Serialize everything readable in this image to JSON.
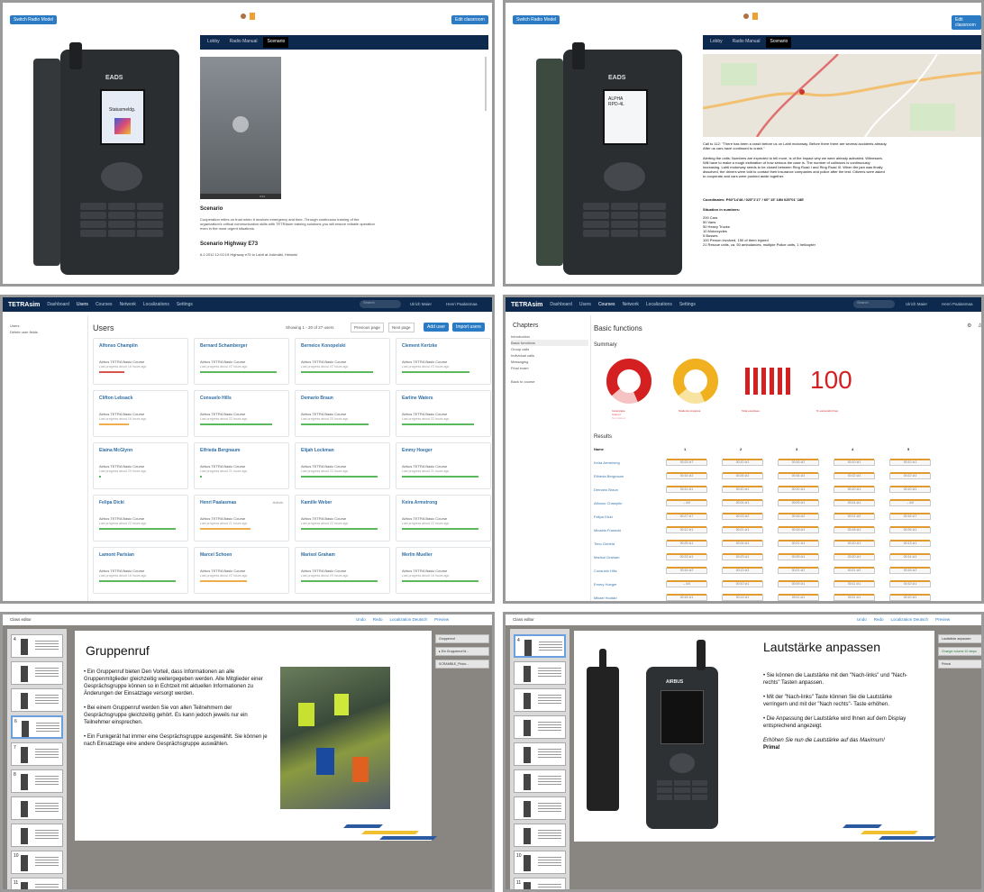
{
  "p1": {
    "switch_btn": "Switch Radio Model",
    "edit_btn": "Edit classroom",
    "tabs": [
      "Lobby",
      "Radio Manual",
      "Scenario"
    ],
    "active_tab": "Scenario",
    "radio_brand": "EADS",
    "radio_screen": "Statusmeldg.",
    "video_time": "2:21",
    "section_title": "Scenario",
    "section_text": "Cooperation relies on trust when it involves emergency and time. Through continuous training of the organization's critical communication skills with TETRAsim training solutions you will ensure reliable operation even in the most urgent situations.",
    "sub_title": "Scenario Highway E73",
    "sub_text": "6.2.2012 12:02:19 Highway e75 to Lahti at Jokimäki, Helsinki"
  },
  "p2": {
    "switch_btn": "Switch Radio Model",
    "edit_btn": "Edit classroom",
    "tabs": [
      "Lobby",
      "Radio Manual",
      "Scenario"
    ],
    "active_tab": "Scenario",
    "radio_brand": "EADS",
    "radio_screen": "ALPHA RPD-4L",
    "call_text": "Call to 112: \"There has been a crash before us on Lahti motorway. Before there there are several accidents already. After us cars have continued to crash.\"",
    "alerting_text": "Alerting the units: Numbers are expected to tell more, is of the impact why we were already activated. Witnesses. Will have to make a rough estimation of how serious the case is. The number of collisions is continuously increasing. Lahti motorway needs to be closed between Ring Road I and Ring Road III. When the jam was finally dissolved, the drivers were told to contact their insurance companies and police after the test. Citizens were asked to cooperate and cars were pushed aside together.",
    "coords": "Coordinates: P60°14'48 / 025°1'17' / 60° 15' 18N 025°01' 18E",
    "situation_title": "Situation in numbers:",
    "situation": [
      "200 Cars",
      "50 Vans",
      "50 Heavy Trucks",
      "10 Motorcycles",
      "5 Busses",
      "100 Person involved, 150 of them injured",
      "21 Rescue units, ca. 50 ambulances, multiple Police units, 1 helicopter"
    ]
  },
  "p3": {
    "brand": "TETRAsim",
    "nav": [
      "Dashboard",
      "Users",
      "Courses",
      "Network",
      "Localizations",
      "Settings"
    ],
    "active_nav": "Users",
    "search_ph": "Search",
    "nav_right": [
      "Ulrich Maier",
      "Henri Paalasmaa"
    ],
    "side": [
      "Users",
      "Delete user fields"
    ],
    "title": "Users",
    "showing": "Showing 1 - 20 of 27 users",
    "prev": "Previous page",
    "next": "Next page",
    "add_user": "Add user",
    "import_users": "Import users",
    "course": "Airbus TETRA Basic Course",
    "admin": "Admin",
    "users": [
      {
        "name": "Alfonso Champlin",
        "progress": "Last progress about 16 hours ago",
        "pct": 0.3,
        "color": "#d9534f"
      },
      {
        "name": "Bernard Schamberger",
        "progress": "Last progress about 22 hours ago",
        "pct": 0.9,
        "color": "#5cb85c"
      },
      {
        "name": "Berneice Konopelski",
        "progress": "Last progress about 22 hours ago",
        "pct": 0.85,
        "color": "#5cb85c"
      },
      {
        "name": "Clement Kertzke",
        "progress": "Last progress about 23 hours ago",
        "pct": 0.8,
        "color": "#5cb85c"
      },
      {
        "name": "Clifton Lebsack",
        "progress": "Last progress about 16 hours ago",
        "pct": 0.35,
        "color": "#f0ad4e"
      },
      {
        "name": "Consuelo Hills",
        "progress": "Last progress about 22 hours ago",
        "pct": 0.85,
        "color": "#5cb85c"
      },
      {
        "name": "Demario Braun",
        "progress": "Last progress about 20 hours ago",
        "pct": 0.8,
        "color": "#5cb85c"
      },
      {
        "name": "Earline Waters",
        "progress": "Last progress about 22 hours ago",
        "pct": 0.85,
        "color": "#5cb85c"
      },
      {
        "name": "Elaina McGlynn",
        "progress": "Last progress about 20 hours ago",
        "pct": 0.0,
        "color": "#5cb85c"
      },
      {
        "name": "Elfrieda Bergnaum",
        "progress": "Last progress about 21 hours ago",
        "pct": 0.0,
        "color": "#5cb85c"
      },
      {
        "name": "Elijah Lockman",
        "progress": "Last progress about 22 hours ago",
        "pct": 0.9,
        "color": "#5cb85c"
      },
      {
        "name": "Emmy Hoeger",
        "progress": "Last progress about 21 hours ago",
        "pct": 0.9,
        "color": "#5cb85c"
      },
      {
        "name": "Felipa Dicki",
        "progress": "Last progress about 22 hours ago",
        "pct": 0.9,
        "color": "#5cb85c"
      },
      {
        "name": "Henri Paalasmaa",
        "progress": "Last progress about 21 hours ago",
        "pct": 0.6,
        "color": "#f0ad4e"
      },
      {
        "name": "Kamille Weber",
        "progress": "Last progress about 22 hours ago",
        "pct": 0.9,
        "color": "#5cb85c"
      },
      {
        "name": "Keira Armstrong",
        "progress": "Last progress about 22 hours ago",
        "pct": 0.9,
        "color": "#5cb85c"
      },
      {
        "name": "Lamont Parisian",
        "progress": "Last progress about 16 hours ago",
        "pct": 0.9,
        "color": "#5cb85c"
      },
      {
        "name": "Marcel Schoen",
        "progress": "Last progress about 22 hours ago",
        "pct": 0.55,
        "color": "#f0ad4e"
      },
      {
        "name": "Marisol Graham",
        "progress": "Last progress about 20 hours ago",
        "pct": 0.9,
        "color": "#5cb85c"
      },
      {
        "name": "Merlin Mueller",
        "progress": "Last progress about 16 hours ago",
        "pct": 0.9,
        "color": "#5cb85c"
      }
    ]
  },
  "p4": {
    "brand": "TETRAsim",
    "nav": [
      "Dashboard",
      "Users",
      "Courses",
      "Network",
      "Localizations",
      "Settings"
    ],
    "active_nav": "Courses",
    "search_ph": "Search",
    "nav_right": [
      "Ulrich Maier",
      "Henri Paalasmaa"
    ],
    "chapters_title": "Chapters",
    "chapters": [
      "Introduction",
      "Basic functions",
      "Group calls",
      "Individual calls",
      "Messaging",
      "Final exam"
    ],
    "active_chapter": "Basic functions",
    "back": "Back to course",
    "title": "Basic functions",
    "summary": "Summary",
    "big_number": "100",
    "legend1": [
      "Incomplete",
      "Started",
      "Not started"
    ],
    "legend2": "Students progress",
    "legend3": "Total exercises",
    "legend4": "% successful tries",
    "results": "Results",
    "col_name": "Name",
    "cols": [
      "1",
      "2",
      "3",
      "4",
      "5"
    ],
    "rows": [
      {
        "name": "Keira Armstrong",
        "cells": [
          "00:23 ⊘7",
          "00:10 ⊘1",
          "00:16 ⊘2",
          "00:10 ⊘1",
          "00:10 ⊘1"
        ]
      },
      {
        "name": "Elfrieda Bergnaum",
        "cells": [
          "00:16 ⊘2",
          "00:26 ⊘2",
          "00:34 ⊘2",
          "00:22 ⊘2",
          "00:22 ⊘2"
        ]
      },
      {
        "name": "Demario Braun",
        "cells": [
          "00:11 ⊘1",
          "00:10 ⊘1",
          "00:10 ⊘1",
          "00:10 ⊘1",
          "00:10 ⊘1"
        ]
      },
      {
        "name": "Alfonso Champlin",
        "cells": [
          "– ⊘0",
          "00:24 ⊘1",
          "00:09 ⊘1",
          "00:14 ⊘1",
          "– ⊘0"
        ]
      },
      {
        "name": "Felipa Dicki",
        "cells": [
          "00:27 ⊘7",
          "00:23 ⊘2",
          "00:16 ⊘2",
          "00:21 ⊘2",
          "00:16 ⊘7"
        ]
      },
      {
        "name": "Micaela Franecki",
        "cells": [
          "00:12 ⊘1",
          "00:21 ⊘1",
          "00:18 ⊘1",
          "00:18 ⊘1",
          "00:25 ⊘1"
        ]
      },
      {
        "name": "Timo Gerfeld",
        "cells": [
          "00:25 ⊘1",
          "00:24 ⊘1",
          "00:21 ⊘1",
          "00:10 ⊘1",
          "00:13 ⊘1"
        ]
      },
      {
        "name": "Marisol Graham",
        "cells": [
          "00:23 ⊘1",
          "00:23 ⊘1",
          "00:39 ⊘1",
          "00:20 ⊘1",
          "00:14 ⊘1"
        ]
      },
      {
        "name": "Consuelo Hills",
        "cells": [
          "00:16 ⊘2",
          "00:13 ⊘2",
          "00:21 ⊘2",
          "00:21 ⊘2",
          "00:18 ⊘2"
        ]
      },
      {
        "name": "Emmy Hoeger",
        "cells": [
          "– ⊘0",
          "00:10 ⊘1",
          "00:09 ⊘1",
          "00:11 ⊘1",
          "00:10 ⊘1"
        ]
      },
      {
        "name": "Mikael Huotari",
        "cells": [
          "00:16 ⊘1",
          "00:13 ⊘1",
          "00:11 ⊘1",
          "00:11 ⊘1",
          "00:10 ⊘1"
        ]
      }
    ]
  },
  "p5": {
    "title_left": "Class editor",
    "toolbar": [
      "Undo",
      "Redo",
      "Localization Deutsch",
      "Preview"
    ],
    "slide_title": "Gruppenruf",
    "bullets": [
      "• Ein Gruppenruf bieten Den Vorteil, dass Informationen an alle Gruppenmitglieder gleichzeitig weitergegeben werden. Alle Mitglieder einer Gesprächsgruppe können so in Echtzeit mit aktuellen Informationen zu Änderungen der Einsatzlage versorgt werden.",
      "• Bei einem Gruppenruf werden Sie von allen Teilnehmern der Gesprächsgruppe gleichzeitig gehört. Es kann jedoch jeweils nur ein Teilnehmer einsprechen.",
      "• Ein Funkgerät hat immer eine Gesprächsgruppe ausgewählt. Sie können je nach Einsatzlage eine andere Gesprächsgruppe auswählen."
    ],
    "right_items": [
      "Gruppenruf",
      "▸ Ein Gruppenruf bi...",
      "SCRAMBLE_Pictur..."
    ],
    "thumb_nums": [
      "4",
      "",
      "",
      "6",
      "7",
      "8",
      "",
      "",
      "10",
      "11"
    ]
  },
  "p6": {
    "title_left": "Class editor",
    "toolbar": [
      "Undo",
      "Redo",
      "Localization Deutsch",
      "Preview"
    ],
    "slide_title": "Lautstärke anpassen",
    "bullets": [
      "• Sie können die Lautstärke mit den \"Nach-links\" und \"Nach-rechts\" Tasten anpassen.",
      "• Mit der \"Nach-links\" Taste können Sie die Lautstärke verringern und mit der \"Nach rechts\"- Taste erhöhen.",
      "• Die Anpassung der Lautstärke wird Ihnen auf dem Display entsprechend angezeigt."
    ],
    "italic": "Erhöhen Sie nun die Lautstärke auf das Maximum!",
    "prima": "Prima!",
    "right_items": [
      "Lautstärke anpassen",
      "Change volume 10 steps",
      "Primal"
    ],
    "radio_brand": "AIRBUS",
    "thumb_nums": [
      "4",
      "",
      "",
      "",
      "",
      "",
      "",
      "",
      "10",
      "11"
    ]
  }
}
